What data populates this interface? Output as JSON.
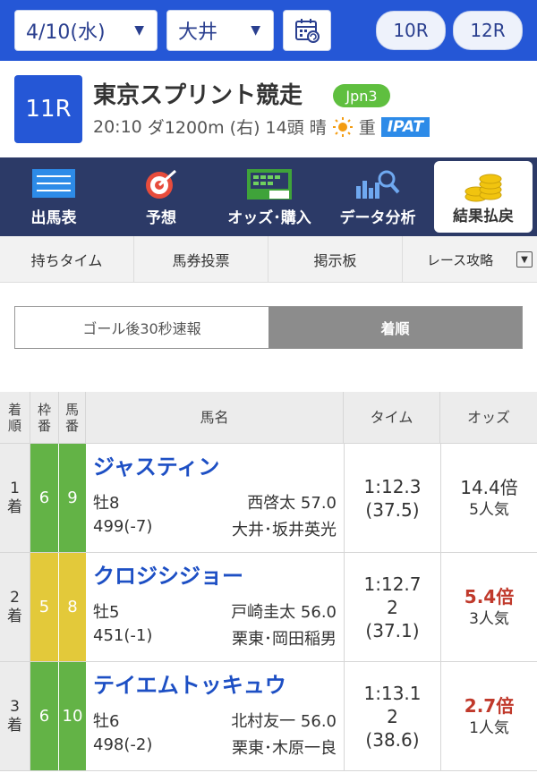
{
  "topbar": {
    "date": "4/10(水)",
    "venue": "大井",
    "prev_race": "10R",
    "next_race": "12R"
  },
  "race": {
    "number": "11R",
    "name": "東京スプリント競走",
    "grade": "Jpn3",
    "time": "20:10",
    "course": "ダ1200m (右)",
    "runners": "14頭",
    "weather": "晴",
    "track": "重",
    "bet_badge": "IPAT"
  },
  "main_nav": [
    {
      "label": "出馬表",
      "icon": "entry-table-icon"
    },
    {
      "label": "予想",
      "icon": "target-icon"
    },
    {
      "label": "オッズ･購入",
      "icon": "odds-board-icon"
    },
    {
      "label": "データ分析",
      "icon": "chart-magnifier-icon"
    },
    {
      "label": "結果払戻",
      "icon": "coins-icon",
      "active": true
    }
  ],
  "sub_nav": [
    "持ちタイム",
    "馬券投票",
    "掲示板",
    "レース攻略"
  ],
  "toggle": {
    "left": "ゴール後30秒速報",
    "right": "着順"
  },
  "table": {
    "headers": {
      "rank": "着順",
      "waku": "枠番",
      "uma": "馬番",
      "name": "馬名",
      "time": "タイム",
      "odds": "オッズ"
    },
    "rows": [
      {
        "rank": "1",
        "rank_suffix": "着",
        "waku": "6",
        "uma": "9",
        "waku_color": "green",
        "name": "ジャスティン",
        "sexage": "牡8",
        "jockey_weight": "西啓太 57.0",
        "body_weight": "499(-7)",
        "trainer": "大井･坂井英光",
        "time": "1:12.3",
        "margin": "",
        "last3f": "(37.5)",
        "odds": "14.4倍",
        "odds_color": "#333333",
        "popularity": "5人気"
      },
      {
        "rank": "2",
        "rank_suffix": "着",
        "waku": "5",
        "uma": "8",
        "waku_color": "yellow",
        "name": "クロジシジョー",
        "sexage": "牡5",
        "jockey_weight": "戸崎圭太 56.0",
        "body_weight": "451(-1)",
        "trainer": "栗東･岡田稲男",
        "time": "1:12.7",
        "margin": "2",
        "last3f": "(37.1)",
        "odds": "5.4倍",
        "odds_color": "#c0392b",
        "popularity": "3人気"
      },
      {
        "rank": "3",
        "rank_suffix": "着",
        "waku": "6",
        "uma": "10",
        "waku_color": "green",
        "name": "テイエムトッキュウ",
        "sexage": "牡6",
        "jockey_weight": "北村友一 56.0",
        "body_weight": "498(-2)",
        "trainer": "栗東･木原一良",
        "time": "1:13.1",
        "margin": "2",
        "last3f": "(38.6)",
        "odds": "2.7倍",
        "odds_color": "#c0392b",
        "popularity": "1人気"
      }
    ]
  }
}
